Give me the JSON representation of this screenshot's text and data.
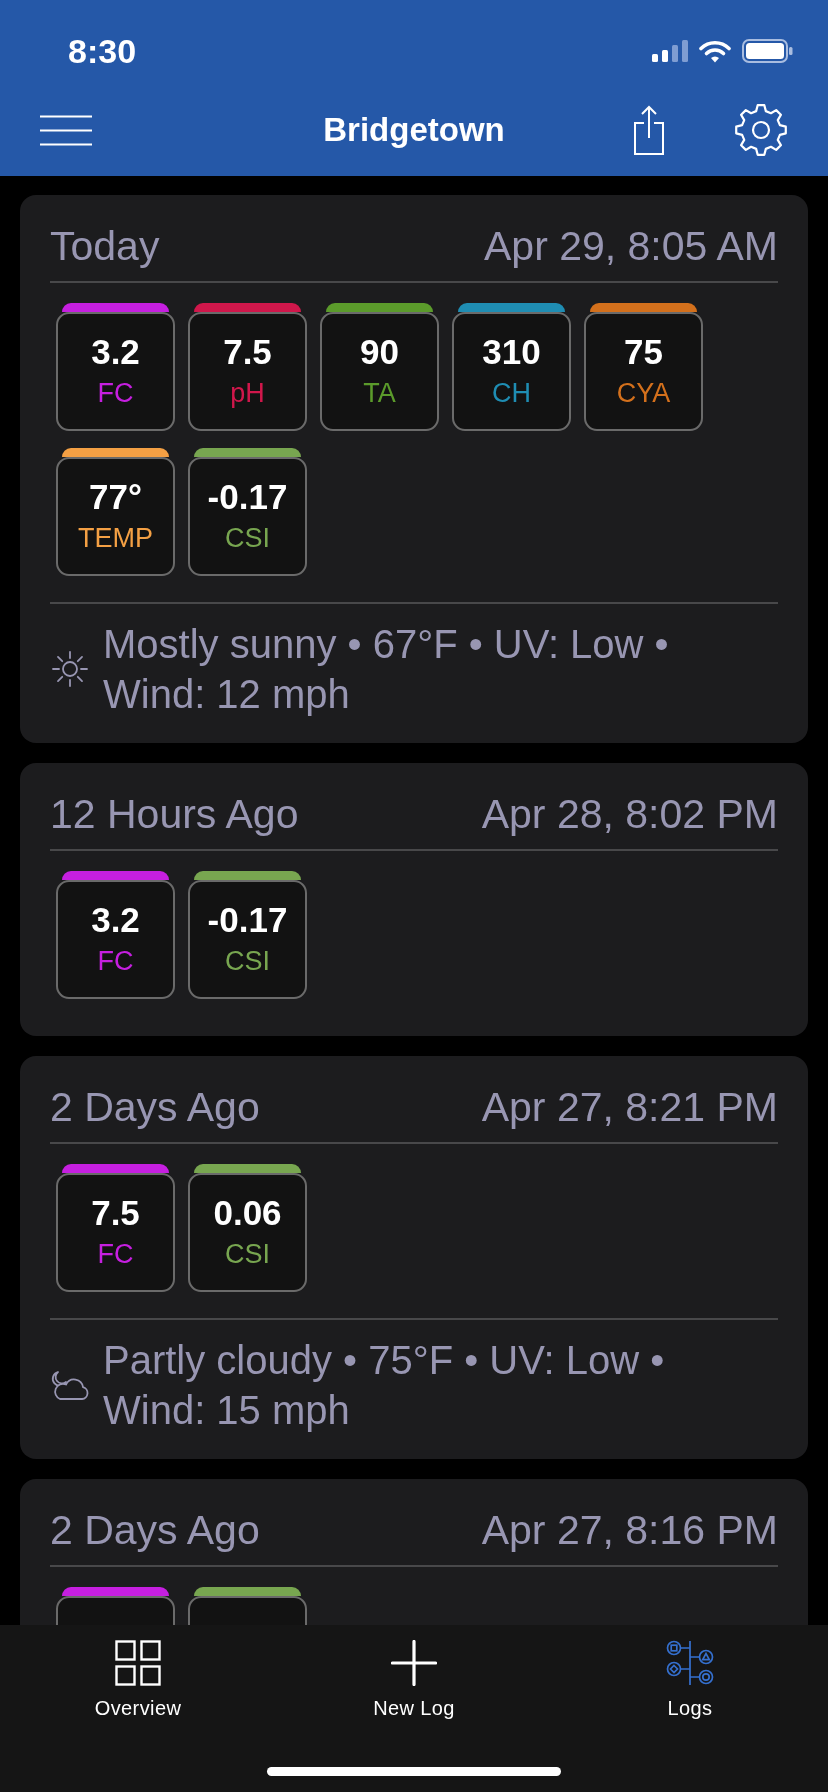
{
  "status_bar": {
    "time": "8:30"
  },
  "nav_bar": {
    "title": "Bridgetown"
  },
  "logs": [
    {
      "title": "Today",
      "date": "Apr 29, 8:05 AM",
      "readings": [
        {
          "value": "3.2",
          "label": "FC",
          "color": "#c61fe0"
        },
        {
          "value": "7.5",
          "label": "pH",
          "color": "#d0174b"
        },
        {
          "value": "90",
          "label": "TA",
          "color": "#5b9b2b"
        },
        {
          "value": "310",
          "label": "CH",
          "color": "#1f8db3"
        },
        {
          "value": "75",
          "label": "CYA",
          "color": "#d3701c"
        },
        {
          "value": "77°",
          "label": "TEMP",
          "color": "#f4a044"
        },
        {
          "value": "-0.17",
          "label": "CSI",
          "color": "#78a650"
        }
      ],
      "weather": {
        "kind": "sunny",
        "text": "Mostly sunny • 67°F • UV: Low • Wind: 12 mph"
      }
    },
    {
      "title": "12 Hours Ago",
      "date": "Apr 28, 8:02 PM",
      "readings": [
        {
          "value": "3.2",
          "label": "FC",
          "color": "#c61fe0"
        },
        {
          "value": "-0.17",
          "label": "CSI",
          "color": "#78a650"
        }
      ]
    },
    {
      "title": "2 Days Ago",
      "date": "Apr 27, 8:21 PM",
      "readings": [
        {
          "value": "7.5",
          "label": "FC",
          "color": "#c61fe0"
        },
        {
          "value": "0.06",
          "label": "CSI",
          "color": "#78a650"
        }
      ],
      "weather": {
        "kind": "cloudy",
        "text": "Partly cloudy • 75°F • UV: Low • Wind: 15 mph"
      }
    },
    {
      "title": "2 Days Ago",
      "date": "Apr 27, 8:16 PM",
      "readings": [
        {
          "color": "#c61fe0"
        },
        {
          "color": "#78a650"
        }
      ]
    }
  ],
  "tab_bar": {
    "tabs": [
      {
        "label": "Overview",
        "kind": "grid",
        "selected": false
      },
      {
        "label": "New Log",
        "kind": "plus",
        "selected": false
      },
      {
        "label": "Logs",
        "kind": "tree",
        "selected": true
      }
    ]
  }
}
